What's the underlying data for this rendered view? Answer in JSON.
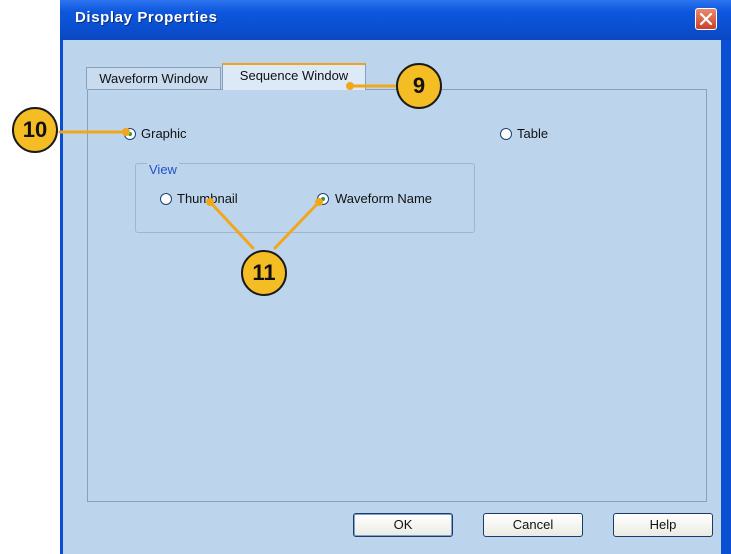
{
  "dialog": {
    "title": "Display Properties",
    "close_icon": "close-icon"
  },
  "tabs": [
    {
      "label": "Waveform Window",
      "selected": false
    },
    {
      "label": "Sequence Window",
      "selected": true
    }
  ],
  "display_mode": {
    "graphic": {
      "label": "Graphic",
      "checked": true
    },
    "table": {
      "label": "Table",
      "checked": false
    }
  },
  "view": {
    "legend": "View",
    "thumbnail": {
      "label": "Thumbnail",
      "checked": false
    },
    "waveform_name": {
      "label": "Waveform Name",
      "checked": true
    }
  },
  "buttons": {
    "ok": "OK",
    "cancel": "Cancel",
    "help": "Help"
  },
  "callouts": {
    "tab": "9",
    "graphic": "10",
    "view_options": "11"
  },
  "colors": {
    "titlebar": "#0a4fd1",
    "client": "#bcd4ec",
    "callout_fill": "#f5bd24",
    "callout_line": "#f2a71b"
  }
}
